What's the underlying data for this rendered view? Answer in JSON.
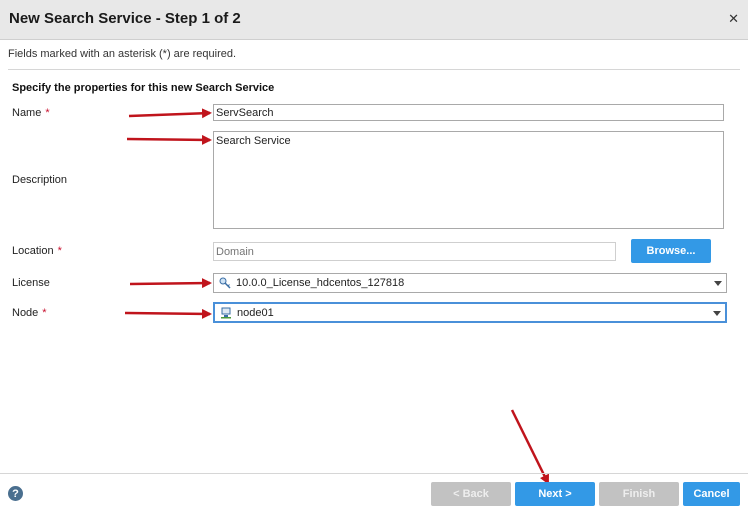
{
  "dialog": {
    "title": "New Search Service - Step 1 of 2",
    "required_note": "Fields marked with an asterisk (*) are required.",
    "section_title": "Specify the properties for this new Search Service"
  },
  "form": {
    "name": {
      "label": "Name",
      "required": "*",
      "value": "ServSearch"
    },
    "description": {
      "label": "Description",
      "value": "Search Service"
    },
    "location": {
      "label": "Location",
      "required": "*",
      "placeholder": "Domain",
      "browse_label": "Browse..."
    },
    "license": {
      "label": "License",
      "value": "10.0.0_License_hdcentos_127818",
      "icon": "license-key-icon"
    },
    "node": {
      "label": "Node",
      "required": "*",
      "value": "node01",
      "icon": "node-icon"
    }
  },
  "footer": {
    "help_glyph": "?",
    "back_label": "< Back",
    "next_label": "Next >",
    "finish_label": "Finish",
    "cancel_label": "Cancel"
  },
  "colors": {
    "primary_button": "#3399e6",
    "disabled_button": "#c2c2c2",
    "required_star": "#c8102e",
    "annotation_arrow": "#c0141c",
    "focus_border": "#4a90d9"
  }
}
